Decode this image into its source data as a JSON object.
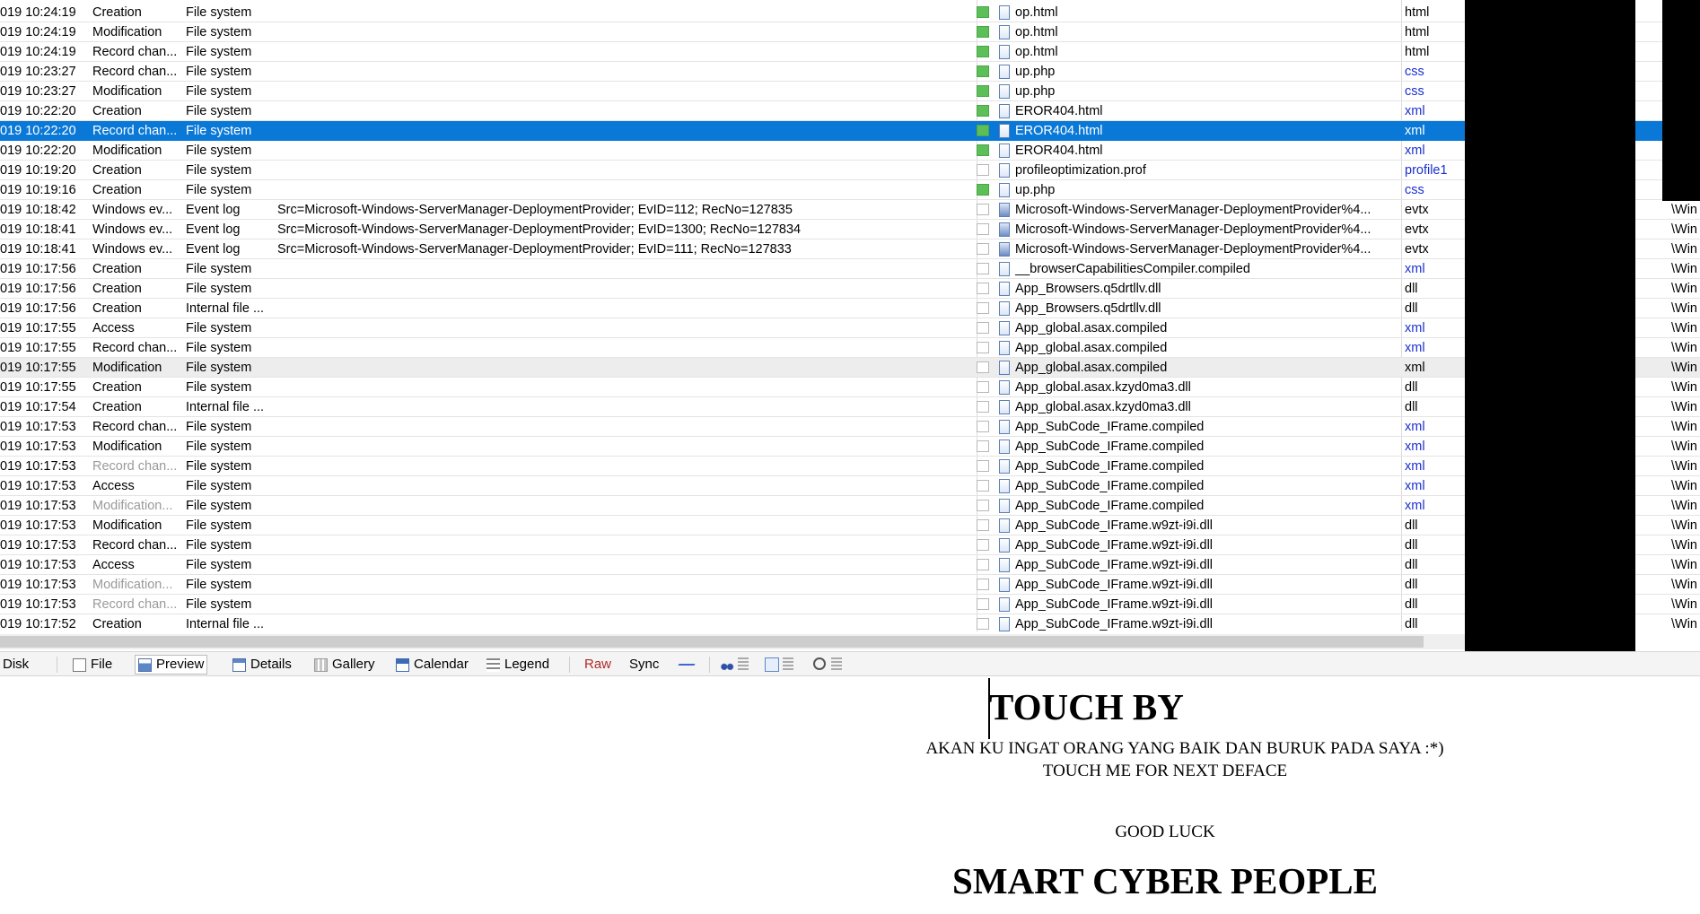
{
  "colors": {
    "selection": "#0a78d7",
    "ext_blue": "#1b2fd0",
    "redaction": "#000000"
  },
  "rows": [
    {
      "date": "019  10:24:19",
      "type": "Creation",
      "source": "File system",
      "desc": "",
      "checked": true,
      "icon": "file-icon",
      "name": "op.html",
      "ext": "html",
      "ext_blue": false
    },
    {
      "date": "019  10:24:19",
      "type": "Modification",
      "source": "File system",
      "desc": "",
      "checked": true,
      "icon": "file-icon",
      "name": "op.html",
      "ext": "html",
      "ext_blue": false
    },
    {
      "date": "019  10:24:19",
      "type": "Record chan...",
      "source": "File system",
      "desc": "",
      "checked": true,
      "icon": "file-icon",
      "name": "op.html",
      "ext": "html",
      "ext_blue": false
    },
    {
      "date": "019  10:23:27",
      "type": "Record chan...",
      "source": "File system",
      "desc": "",
      "checked": true,
      "icon": "file-icon",
      "name": "up.php",
      "ext": "css",
      "ext_blue": true
    },
    {
      "date": "019  10:23:27",
      "type": "Modification",
      "source": "File system",
      "desc": "",
      "checked": true,
      "icon": "file-icon",
      "name": "up.php",
      "ext": "css",
      "ext_blue": true
    },
    {
      "date": "019  10:22:20",
      "type": "Creation",
      "source": "File system",
      "desc": "",
      "checked": true,
      "icon": "file-icon",
      "name": "EROR404.html",
      "ext": "xml",
      "ext_blue": true
    },
    {
      "date": "019  10:22:20",
      "type": "Record chan...",
      "source": "File system",
      "desc": "",
      "checked": true,
      "icon": "file-icon",
      "name": "EROR404.html",
      "ext": "xml",
      "ext_blue": true,
      "selected": true
    },
    {
      "date": "019  10:22:20",
      "type": "Modification",
      "source": "File system",
      "desc": "",
      "checked": true,
      "icon": "file-icon",
      "name": "EROR404.html",
      "ext": "xml",
      "ext_blue": true
    },
    {
      "date": "019  10:19:20",
      "type": "Creation",
      "source": "File system",
      "desc": "",
      "checked": false,
      "icon": "file-icon",
      "name": "profileoptimization.prof",
      "ext": "profile1",
      "ext_blue": true
    },
    {
      "date": "019  10:19:16",
      "type": "Creation",
      "source": "File system",
      "desc": "",
      "checked": true,
      "icon": "file-icon",
      "name": "up.php",
      "ext": "css",
      "ext_blue": true
    },
    {
      "date": "019  10:18:42",
      "type": "Windows ev...",
      "source": "Event log",
      "desc": "Src=Microsoft-Windows-ServerManager-DeploymentProvider; EvID=112; RecNo=127835",
      "checked": false,
      "icon": "event-log-icon",
      "name": "Microsoft-Windows-ServerManager-DeploymentProvider%4...",
      "ext": "evtx",
      "ext_blue": false
    },
    {
      "date": "019  10:18:41",
      "type": "Windows ev...",
      "source": "Event log",
      "desc": "Src=Microsoft-Windows-ServerManager-DeploymentProvider; EvID=1300; RecNo=127834",
      "checked": false,
      "icon": "event-log-icon",
      "name": "Microsoft-Windows-ServerManager-DeploymentProvider%4...",
      "ext": "evtx",
      "ext_blue": false
    },
    {
      "date": "019  10:18:41",
      "type": "Windows ev...",
      "source": "Event log",
      "desc": "Src=Microsoft-Windows-ServerManager-DeploymentProvider; EvID=111; RecNo=127833",
      "checked": false,
      "icon": "event-log-icon",
      "name": "Microsoft-Windows-ServerManager-DeploymentProvider%4...",
      "ext": "evtx",
      "ext_blue": false
    },
    {
      "date": "019  10:17:56",
      "type": "Creation",
      "source": "File system",
      "desc": "",
      "checked": false,
      "icon": "file-icon",
      "name": "__browserCapabilitiesCompiler.compiled",
      "ext": "xml",
      "ext_blue": true
    },
    {
      "date": "019  10:17:56",
      "type": "Creation",
      "source": "File system",
      "desc": "",
      "checked": false,
      "icon": "file-icon",
      "name": "App_Browsers.q5drtllv.dll",
      "ext": "dll",
      "ext_blue": false
    },
    {
      "date": "019  10:17:56",
      "type": "Creation",
      "source": "Internal file ...",
      "desc": "",
      "checked": false,
      "icon": "file-icon",
      "name": "App_Browsers.q5drtllv.dll",
      "ext": "dll",
      "ext_blue": false
    },
    {
      "date": "019  10:17:55",
      "type": "Access",
      "source": "File system",
      "desc": "",
      "checked": false,
      "icon": "file-icon",
      "name": "App_global.asax.compiled",
      "ext": "xml",
      "ext_blue": true
    },
    {
      "date": "019  10:17:55",
      "type": "Record chan...",
      "source": "File system",
      "desc": "",
      "checked": false,
      "icon": "file-icon",
      "name": "App_global.asax.compiled",
      "ext": "xml",
      "ext_blue": true
    },
    {
      "date": "019  10:17:55",
      "type": "Modification",
      "source": "File system",
      "desc": "",
      "checked": false,
      "icon": "file-icon",
      "name": "App_global.asax.compiled",
      "ext": "xml",
      "ext_blue": false,
      "alt": true
    },
    {
      "date": "019  10:17:55",
      "type": "Creation",
      "source": "File system",
      "desc": "",
      "checked": false,
      "icon": "file-icon",
      "name": "App_global.asax.kzyd0ma3.dll",
      "ext": "dll",
      "ext_blue": false
    },
    {
      "date": "019  10:17:54",
      "type": "Creation",
      "source": "Internal file ...",
      "desc": "",
      "checked": false,
      "icon": "file-icon",
      "name": "App_global.asax.kzyd0ma3.dll",
      "ext": "dll",
      "ext_blue": false
    },
    {
      "date": "019  10:17:53",
      "type": "Record chan...",
      "source": "File system",
      "desc": "",
      "checked": false,
      "icon": "file-icon",
      "name": "App_SubCode_IFrame.compiled",
      "ext": "xml",
      "ext_blue": true
    },
    {
      "date": "019  10:17:53",
      "type": "Modification",
      "source": "File system",
      "desc": "",
      "checked": false,
      "icon": "file-icon",
      "name": "App_SubCode_IFrame.compiled",
      "ext": "xml",
      "ext_blue": true
    },
    {
      "date": "019  10:17:53",
      "type": "Record chan...",
      "source": "File system",
      "desc": "",
      "checked": false,
      "icon": "file-icon",
      "name": "App_SubCode_IFrame.compiled",
      "ext": "xml",
      "ext_blue": true,
      "dim": true
    },
    {
      "date": "019  10:17:53",
      "type": "Access",
      "source": "File system",
      "desc": "",
      "checked": false,
      "icon": "file-icon",
      "name": "App_SubCode_IFrame.compiled",
      "ext": "xml",
      "ext_blue": true
    },
    {
      "date": "019  10:17:53",
      "type": "Modification...",
      "source": "File system",
      "desc": "",
      "checked": false,
      "icon": "file-icon",
      "name": "App_SubCode_IFrame.compiled",
      "ext": "xml",
      "ext_blue": true,
      "dim": true
    },
    {
      "date": "019  10:17:53",
      "type": "Modification",
      "source": "File system",
      "desc": "",
      "checked": false,
      "icon": "file-icon",
      "name": "App_SubCode_IFrame.w9zt-i9i.dll",
      "ext": "dll",
      "ext_blue": false
    },
    {
      "date": "019  10:17:53",
      "type": "Record chan...",
      "source": "File system",
      "desc": "",
      "checked": false,
      "icon": "file-icon",
      "name": "App_SubCode_IFrame.w9zt-i9i.dll",
      "ext": "dll",
      "ext_blue": false
    },
    {
      "date": "019  10:17:53",
      "type": "Access",
      "source": "File system",
      "desc": "",
      "checked": false,
      "icon": "file-icon",
      "name": "App_SubCode_IFrame.w9zt-i9i.dll",
      "ext": "dll",
      "ext_blue": false
    },
    {
      "date": "019  10:17:53",
      "type": "Modification...",
      "source": "File system",
      "desc": "",
      "checked": false,
      "icon": "file-icon",
      "name": "App_SubCode_IFrame.w9zt-i9i.dll",
      "ext": "dll",
      "ext_blue": false,
      "dim": true
    },
    {
      "date": "019  10:17:53",
      "type": "Record chan...",
      "source": "File system",
      "desc": "",
      "checked": false,
      "icon": "file-icon",
      "name": "App_SubCode_IFrame.w9zt-i9i.dll",
      "ext": "dll",
      "ext_blue": false,
      "dim": true
    },
    {
      "date": "019  10:17:52",
      "type": "Creation",
      "source": "Internal file ...",
      "desc": "",
      "checked": false,
      "icon": "file-icon",
      "name": "App_SubCode_IFrame.w9zt-i9i.dll",
      "ext": "dll",
      "ext_blue": false
    }
  ],
  "path_fragment": "\\Win",
  "tabs": {
    "disk": "Disk",
    "file": "File",
    "preview": "Preview",
    "details": "Details",
    "gallery": "Gallery",
    "calendar": "Calendar",
    "legend": "Legend",
    "raw": "Raw",
    "sync": "Sync"
  },
  "preview": {
    "title": "TOUCH BY",
    "line1": "AKAN KU INGAT ORANG YANG BAIK DAN BURUK PADA SAYA :*)",
    "line2": "TOUCH ME FOR NEXT DEFACE",
    "line3": "GOOD LUCK",
    "signature": "SMART CYBER PEOPLE"
  }
}
